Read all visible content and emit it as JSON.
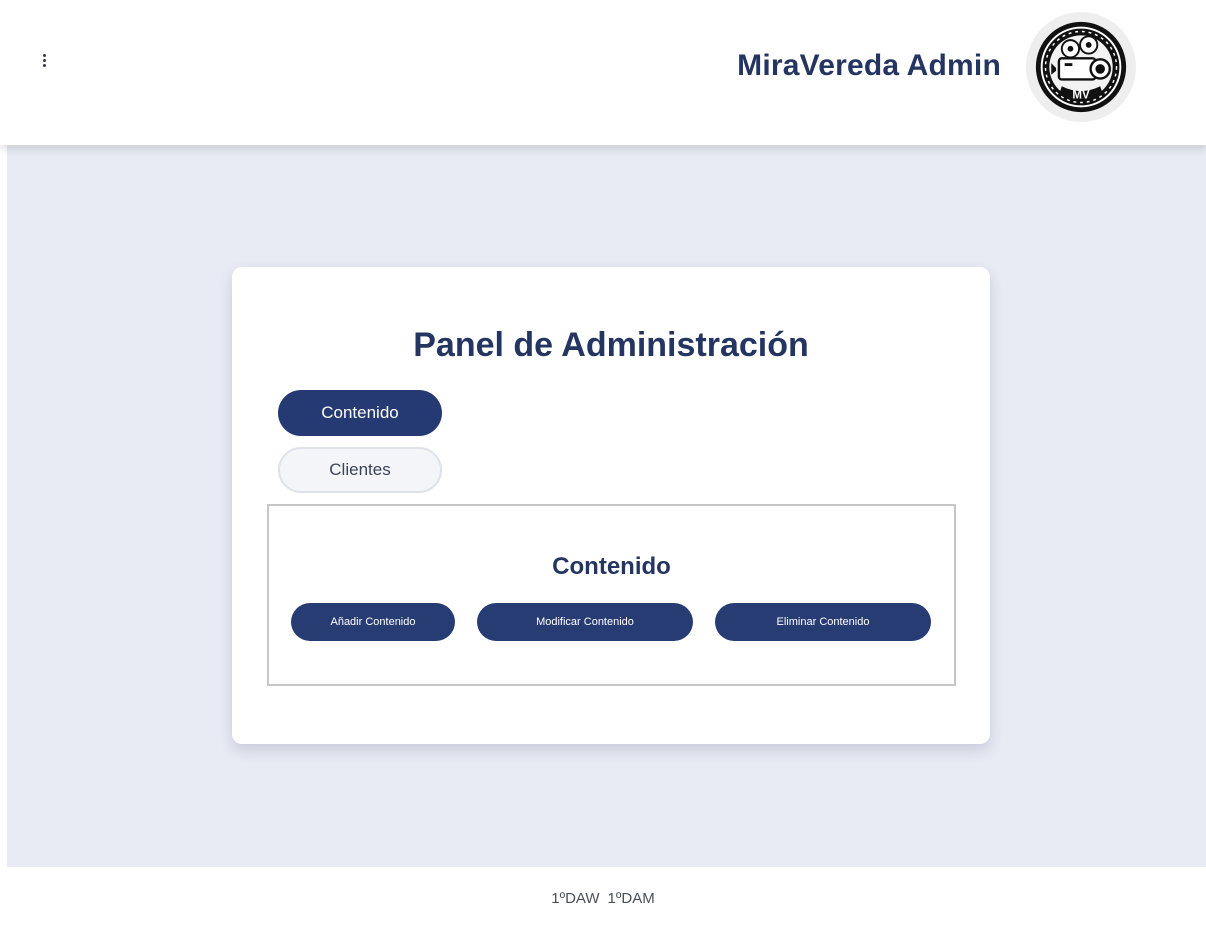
{
  "header": {
    "menu_icon": "kebab-menu-icon",
    "title": "MiraVereda Admin",
    "logo": {
      "icon": "film-camera-logo",
      "text": "MV"
    }
  },
  "panel": {
    "title": "Panel de Administración",
    "tabs": [
      {
        "label": "Contenido",
        "active": true
      },
      {
        "label": "Clientes",
        "active": false
      }
    ],
    "section": {
      "title": "Contenido",
      "actions": [
        {
          "label": "Añadir Contenido"
        },
        {
          "label": "Modificar Contenido"
        },
        {
          "label": "Eliminar Contenido"
        }
      ]
    }
  },
  "footer": {
    "items": [
      "1ºDAW",
      "1ºDAM"
    ]
  },
  "colors": {
    "primary": "#253a72",
    "title_text": "#253562",
    "page_background": "#e8eaf4",
    "card_background": "#ffffff"
  }
}
